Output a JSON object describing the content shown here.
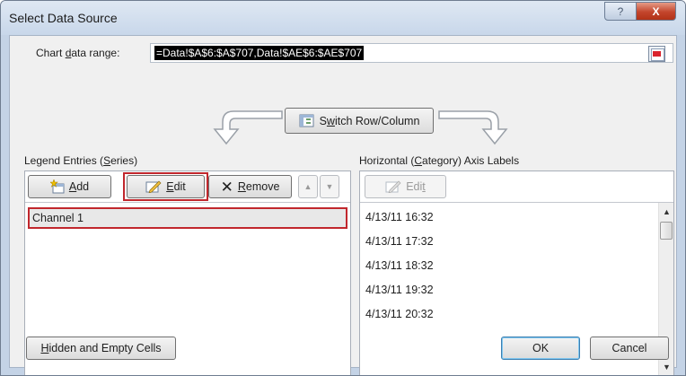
{
  "window": {
    "title": "Select Data Source",
    "help_glyph": "?",
    "close_glyph": "X"
  },
  "range": {
    "label_pre": "Chart ",
    "label_accel": "d",
    "label_post": "ata range:",
    "value": "=Data!$A$6:$A$707,Data!$AE$6:$AE$707"
  },
  "switch_button": {
    "pre": "S",
    "accel": "w",
    "post": "itch Row/Column"
  },
  "legend": {
    "label_pre": "Legend Entries (",
    "label_accel": "S",
    "label_post": "eries)",
    "add_accel": "A",
    "add_post": "dd",
    "edit_accel": "E",
    "edit_post": "dit",
    "remove_accel": "R",
    "remove_post": "emove",
    "up_glyph": "▲",
    "down_glyph": "▼",
    "items": [
      "Channel 1"
    ]
  },
  "axis": {
    "label_pre": "Horizontal (",
    "label_accel": "C",
    "label_post": "ategory) Axis Labels",
    "edit_pre": "Edi",
    "edit_accel": "t",
    "items": [
      "4/13/11 16:32",
      "4/13/11 17:32",
      "4/13/11 18:32",
      "4/13/11 19:32",
      "4/13/11 20:32"
    ]
  },
  "footer": {
    "hidden_accel": "H",
    "hidden_post": "idden and Empty Cells",
    "ok_label": "OK",
    "cancel_label": "Cancel"
  },
  "colors": {
    "highlight_red": "#c1272d",
    "selection_black": "#000000",
    "dialog_gray": "#f0f0f0",
    "frame_blue": "#c4d3e6"
  }
}
